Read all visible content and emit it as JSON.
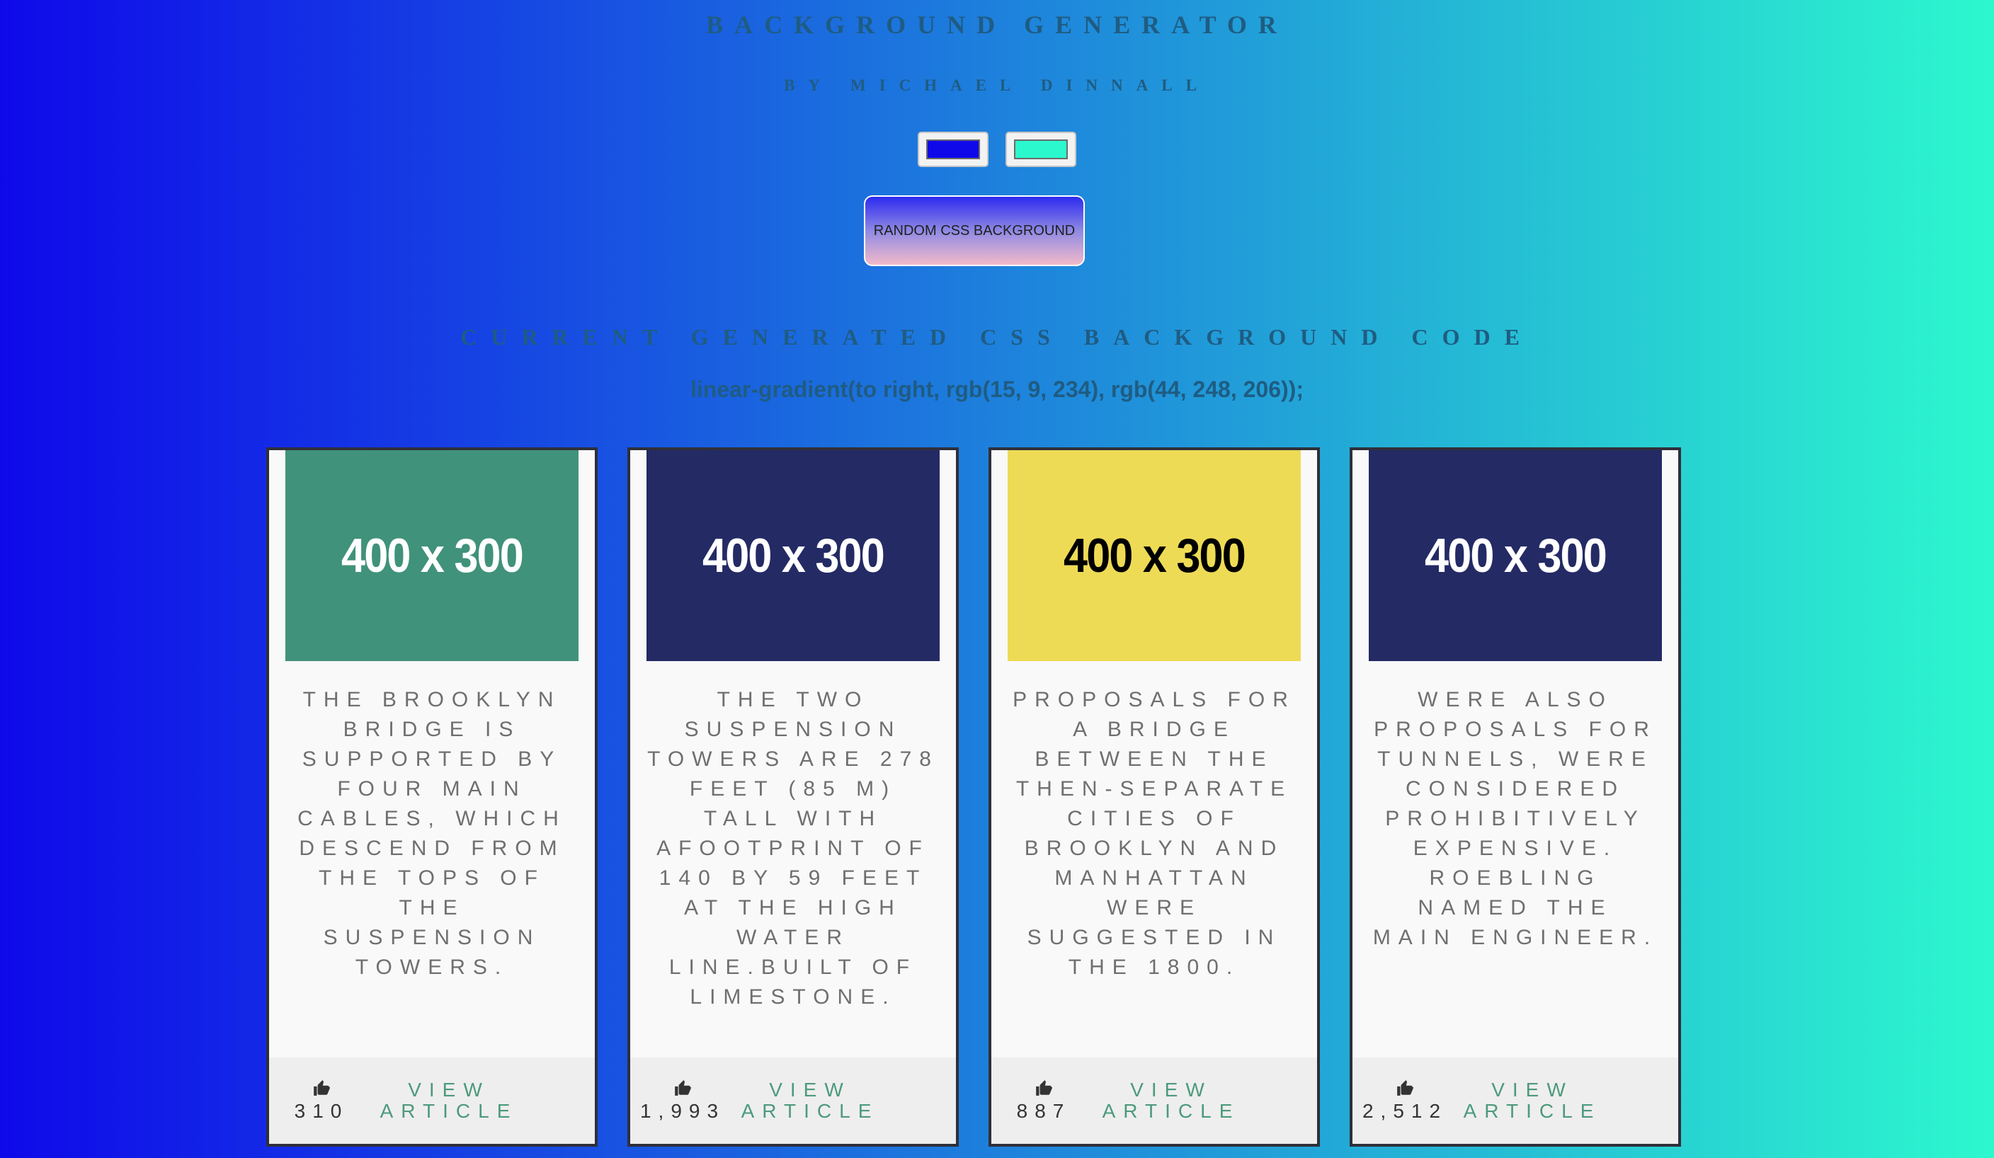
{
  "header": {
    "title": "BACKGROUND GENERATOR",
    "byline": "BY MICHAEL DINNALL"
  },
  "color_pickers": {
    "color1": "#0f09ea",
    "color2": "#2cf8ce"
  },
  "random_button": {
    "label": "RANDOM CSS BACKGROUND"
  },
  "current_css": {
    "heading": "CURRENT GENERATED CSS BACKGROUND CODE",
    "code": "linear-gradient(to right, rgb(15, 9, 234), rgb(44, 248, 206));"
  },
  "cards": [
    {
      "image_label": "400 x 300",
      "image_bg": "#40927a",
      "image_fg": "#ffffff",
      "text": "THE BROOKLYN BRIDGE IS SUPPORTED BY FOUR MAIN CABLES, WHICH DESCEND FROM THE TOPS OF THE SUSPENSION TOWERS.",
      "likes": "310",
      "link": "VIEW ARTICLE"
    },
    {
      "image_label": "400 x 300",
      "image_bg": "#242a64",
      "image_fg": "#ffffff",
      "text": "THE TWO SUSPENSION TOWERS ARE 278 FEET (85 M) TALL WITH AFOOTPRINT OF 140 BY 59 FEET AT THE HIGH WATER LINE.BUILT OF LIMESTONE.",
      "likes": "1,993",
      "link": "VIEW ARTICLE"
    },
    {
      "image_label": "400 x 300",
      "image_bg": "#eedb55",
      "image_fg": "#000000",
      "text": "PROPOSALS FOR A BRIDGE BETWEEN THE THEN-SEPARATE CITIES OF BROOKLYN AND MANHATTAN WERE SUGGESTED IN THE 1800.",
      "likes": "887",
      "link": "VIEW ARTICLE"
    },
    {
      "image_label": "400 x 300",
      "image_bg": "#242a64",
      "image_fg": "#ffffff",
      "text": "WERE ALSO PROPOSALS FOR TUNNELS, WERE CONSIDERED PROHIBITIVELY EXPENSIVE. ROEBLING NAMED THE MAIN ENGINEER.",
      "likes": "2,512",
      "link": "VIEW ARTICLE"
    }
  ]
}
